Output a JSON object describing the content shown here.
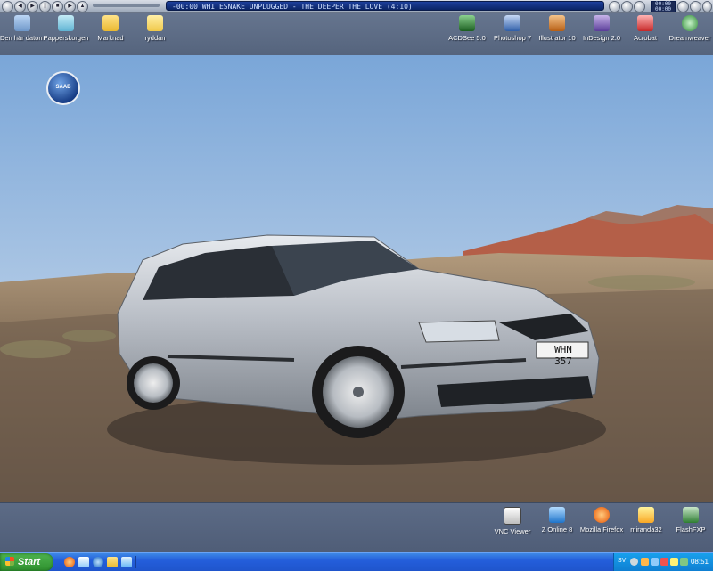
{
  "player": {
    "track_text": "-00:00 WHITESNAKE UNPLUGGED - THE DEEPER THE LOVE (4:10)",
    "clock_top": "00:00",
    "clock_bottom": "00:00"
  },
  "desktop_top_left": [
    {
      "label": "Den här datorn",
      "icon": "computer-icon",
      "color": "#8fb7e8"
    },
    {
      "label": "Papperskorgen",
      "icon": "recycle-bin-icon",
      "color": "#7ec8e3"
    },
    {
      "label": "Marknad",
      "icon": "folder-icon",
      "color": "#f2c94c"
    },
    {
      "label": "ryddan",
      "icon": "folder-open-icon",
      "color": "#f2d06b"
    }
  ],
  "desktop_top_right": [
    {
      "label": "ACDSee 5.0",
      "icon": "acdsee-icon",
      "color": "#2e7d32"
    },
    {
      "label": "Photoshop 7",
      "icon": "photoshop-icon",
      "color": "#3b6bb8"
    },
    {
      "label": "Illustrator 10",
      "icon": "illustrator-icon",
      "color": "#d17a23"
    },
    {
      "label": "InDesign 2.0",
      "icon": "indesign-icon",
      "color": "#6d4aa8"
    },
    {
      "label": "Acrobat",
      "icon": "acrobat-icon",
      "color": "#d32f2f"
    },
    {
      "label": "Dreamweaver",
      "icon": "dreamweaver-icon",
      "color": "#66bb6a"
    }
  ],
  "desktop_bottom_right": [
    {
      "label": "VNC Viewer",
      "icon": "vnc-icon",
      "color": "#e0e0e0"
    },
    {
      "label": "Z Online 8",
      "icon": "z-online-icon",
      "color": "#42a5f5"
    },
    {
      "label": "Mozilla Firefox",
      "icon": "firefox-icon",
      "color": "#ef6c00"
    },
    {
      "label": "miranda32",
      "icon": "miranda-icon",
      "color": "#fbc02d"
    },
    {
      "label": "FlashFXP",
      "icon": "flashfxp-icon",
      "color": "#43a047"
    }
  ],
  "wallpaper": {
    "brand_logo_text": "SAAB",
    "license_plate": "WHN 357"
  },
  "taskbar": {
    "start_label": "Start",
    "quick_launch": [
      "firefox-icon",
      "outlook-icon",
      "ie-icon",
      "folder-icon",
      "show-desktop-icon"
    ],
    "tray_language": "SV",
    "clock": "08:51"
  }
}
